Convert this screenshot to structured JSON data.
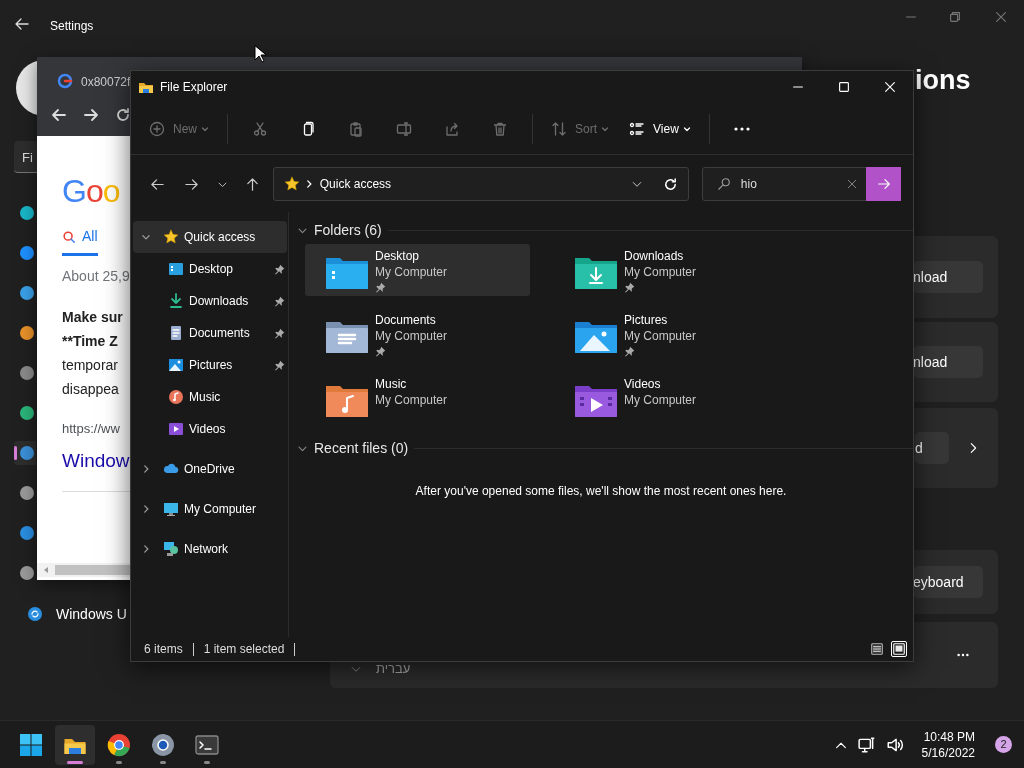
{
  "settings_window": {
    "title": "Settings",
    "search_fragment": "Fi",
    "nav_items": [
      {
        "selected": false
      },
      {
        "selected": false
      },
      {
        "selected": false
      },
      {
        "selected": false
      },
      {
        "selected": false
      },
      {
        "selected": false
      },
      {
        "selected": true
      },
      {
        "selected": false
      },
      {
        "selected": false
      },
      {
        "selected": false
      },
      {
        "label": "Windows U",
        "selected": false
      }
    ],
    "heading_fragment": "ions",
    "cards": [
      {
        "button": "nload"
      },
      {
        "button": "nload"
      },
      {
        "button": "d",
        "chevron": true
      },
      {
        "button": "eyboard"
      },
      {
        "language": "עברית",
        "more": true
      }
    ]
  },
  "browser_window": {
    "tab_title": "0x80072f",
    "logo_fragment": "Goo",
    "search_tab": "All",
    "result_count": "About 25,9",
    "snippet_lines": [
      {
        "text": "Make sur",
        "bold": true
      },
      {
        "text": "**Time Z",
        "bold": true
      },
      {
        "text": "temporar",
        "bold": false
      },
      {
        "text": "disappea",
        "bold": false
      }
    ],
    "url": "https://ww",
    "link": "Window"
  },
  "file_explorer": {
    "title": "File Explorer",
    "toolbar": [
      {
        "kind": "new",
        "label": "New",
        "disabled": true
      },
      {
        "kind": "cut",
        "disabled": true
      },
      {
        "kind": "copy",
        "disabled": false
      },
      {
        "kind": "paste",
        "disabled": true
      },
      {
        "kind": "rename",
        "disabled": true
      },
      {
        "kind": "share",
        "disabled": true
      },
      {
        "kind": "delete",
        "disabled": true
      },
      {
        "kind": "sort",
        "label": "Sort",
        "disabled": true
      },
      {
        "kind": "view",
        "label": "View",
        "disabled": false
      },
      {
        "kind": "more"
      }
    ],
    "address": {
      "path": "Quick access"
    },
    "search": {
      "value": "hio"
    },
    "nav_pane": [
      {
        "label": "Quick access",
        "expanded": true,
        "selected": true,
        "children": [
          {
            "label": "Desktop",
            "pinned": true
          },
          {
            "label": "Downloads",
            "pinned": true
          },
          {
            "label": "Documents",
            "pinned": true
          },
          {
            "label": "Pictures",
            "pinned": true
          },
          {
            "label": "Music",
            "pinned": false
          },
          {
            "label": "Videos",
            "pinned": false
          }
        ]
      },
      {
        "label": "OneDrive",
        "expanded": false,
        "selected": false
      },
      {
        "label": "My Computer",
        "expanded": false,
        "selected": false
      },
      {
        "label": "Network",
        "expanded": false,
        "selected": false
      }
    ],
    "groups": [
      {
        "title": "Folders (6)",
        "expanded": true,
        "folders": [
          {
            "name": "Desktop",
            "location": "My Computer",
            "pinned": true,
            "selected": true
          },
          {
            "name": "Downloads",
            "location": "My Computer",
            "pinned": true,
            "selected": false
          },
          {
            "name": "Documents",
            "location": "My Computer",
            "pinned": true,
            "selected": false
          },
          {
            "name": "Pictures",
            "location": "My Computer",
            "pinned": true,
            "selected": false
          },
          {
            "name": "Music",
            "location": "My Computer",
            "pinned": false,
            "selected": false
          },
          {
            "name": "Videos",
            "location": "My Computer",
            "pinned": false,
            "selected": false
          }
        ]
      },
      {
        "title": "Recent files (0)",
        "expanded": true,
        "empty_message": "After you've opened some files, we'll show the most recent ones here."
      }
    ],
    "status_bar": {
      "item_count": "6 items",
      "selection": "1 item selected",
      "views": [
        {
          "selected": false
        },
        {
          "selected": true
        }
      ]
    }
  },
  "taskbar": {
    "apps": [
      {
        "kind": "start",
        "selected": false
      },
      {
        "kind": "explorer",
        "selected": true
      },
      {
        "kind": "browser",
        "selected": false
      },
      {
        "kind": "settings",
        "selected": false
      },
      {
        "kind": "terminal",
        "selected": false
      }
    ],
    "clock_time": "10:48 PM",
    "clock_date": "5/16/2022",
    "notifications": "2"
  }
}
